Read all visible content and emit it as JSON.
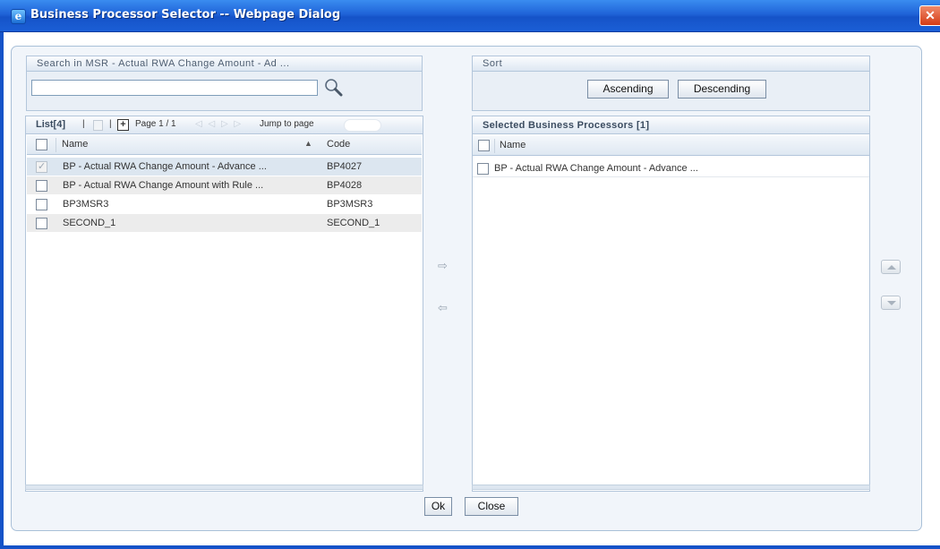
{
  "window": {
    "title": "Business Processor Selector -- Webpage Dialog",
    "icon": "ie-icon",
    "close_glyph": "✕"
  },
  "search": {
    "title": "Search in MSR - Actual RWA Change Amount - Ad ...",
    "value": "",
    "placeholder": ""
  },
  "sort": {
    "title": "Sort",
    "ascending_label": "Ascending",
    "descending_label": "Descending"
  },
  "list": {
    "title": "List[4]",
    "page_text": "Page 1 / 1",
    "jump_label": "Jump to page",
    "columns": {
      "name": "Name",
      "code": "Code"
    },
    "rows": [
      {
        "name": "BP - Actual RWA Change Amount - Advance ...",
        "code": "BP4027",
        "checked": true
      },
      {
        "name": "BP - Actual RWA Change Amount with Rule ...",
        "code": "BP4028",
        "checked": false
      },
      {
        "name": "BP3MSR3",
        "code": "BP3MSR3",
        "checked": false
      },
      {
        "name": "SECOND_1",
        "code": "SECOND_1",
        "checked": false
      }
    ]
  },
  "selected": {
    "title": "Selected Business Processors [1]",
    "column_name": "Name",
    "rows": [
      {
        "name": "BP - Actual RWA Change Amount - Advance ..."
      }
    ]
  },
  "footer": {
    "ok_label": "Ok",
    "close_label": "Close"
  },
  "colors": {
    "titlebar": "#1553c8",
    "selected_row": "#dce6f0",
    "alt_row": "#ececec"
  }
}
